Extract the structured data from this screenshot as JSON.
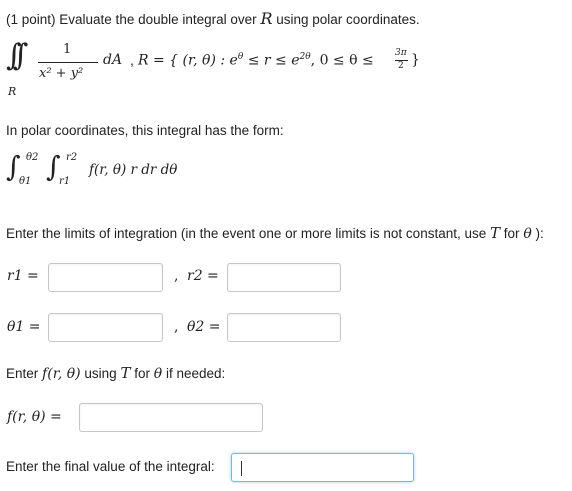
{
  "problem": {
    "header": "(1 point) Evaluate the double integral over",
    "region_letter": "R",
    "header_end": "using polar coordinates.",
    "integral": {
      "numerator": "1",
      "denominator": "x² + y²",
      "differential": "dA",
      "region_def": "R = { (r, θ) : e",
      "exp_theta": "θ",
      "mid": "≤ r ≤ e",
      "exp_2theta": "2θ",
      "range": ", 0 ≤ θ ≤",
      "frac_num": "3π",
      "frac_den": "2",
      "close": "}",
      "sub_R": "R"
    }
  },
  "polar_intro": "In polar coordinates, this integral has the form:",
  "polar_form": {
    "upper_outer": "θ2",
    "lower_outer": "θ1",
    "upper_inner": "r2",
    "lower_inner": "r1",
    "integrand": "f(r, θ) r dr dθ"
  },
  "limits_instruction": {
    "before": "Enter the limits of integration (in the event one or more limits is not constant, use",
    "T": "T",
    "for_word": "for",
    "theta": "θ",
    "after": "):"
  },
  "fields": {
    "r1_label": "r1 =",
    "r2_label": "r2 =",
    "theta1_label": "θ1 =",
    "theta2_label": "θ2 =",
    "comma": ","
  },
  "f_instruction": {
    "enter": "Enter",
    "f_expr": "f(r, θ)",
    "using": "using",
    "T": "T",
    "for_word": "for",
    "theta": "θ",
    "tail": "if needed:"
  },
  "f_label": "f(r, θ) =",
  "final_label": "Enter the final value of the integral:"
}
